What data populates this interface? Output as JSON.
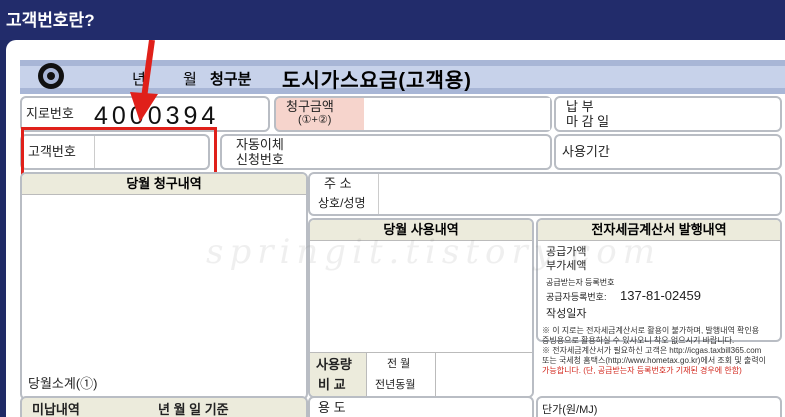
{
  "page": {
    "title": "고객번호란?"
  },
  "bill": {
    "year_label": "년",
    "month_label": "월",
    "period_label": "청구분",
    "doc_title": "도시가스요금(고객용)",
    "giro_label": "지로번호",
    "giro_number": "4000394",
    "charge_label": "청구금액",
    "charge_sub": "(①+②)",
    "due_top": "납 부",
    "due_bottom": "마 감 일",
    "customer_no_label": "고객번호",
    "autopay_top": "자동이체",
    "autopay_bottom": "신청번호",
    "usage_period_label": "사용기간",
    "current_claims_label": "당월 청구내역",
    "address_label": "주 소",
    "name_label": "상호/성명",
    "current_usage_label": "당월 사용내역",
    "einvoice_label": "전자세금계산서 발행내역",
    "supply_value_label": "공급가액",
    "vat_label": "부가세액",
    "receiver_label": "공급받는자 등록번호",
    "supplier_label": "공급자등록번호:",
    "supplier_number": "137-81-02459",
    "date_label": "작성일자",
    "notes": [
      "※ 이 지로는 전자세금계산서로 활용이 불가하며, 발행내역 확인용",
      "증빙용으로 활용하실 수 있사오니 착오 없으시기 바랍니다.",
      "※ 전자세금계산서가 필요하신 고객은 http://icgas.taxbill365.com",
      "또는 국세청 홈택스(http://www.hometax.go.kr)에서 조회 및 출력이",
      "가능합니다. (단, 공급받는자 등록번호가 기재된 경우에 한함)"
    ],
    "usage_label_top": "사용량",
    "usage_label_bottom": "비 교",
    "prev_month": "전 월",
    "prev_year_month": "전년동월",
    "subtotal_label": "당월소계(①)",
    "arrears_label": "미납내역",
    "arrears_date": "년 월 일 기준",
    "purpose_label": "용 도",
    "unit_price_label": "단가(원/MJ)",
    "watermark": "springit.tistory.com"
  },
  "colors": {
    "highlight": "#e0201a",
    "header": "#222c6b"
  }
}
